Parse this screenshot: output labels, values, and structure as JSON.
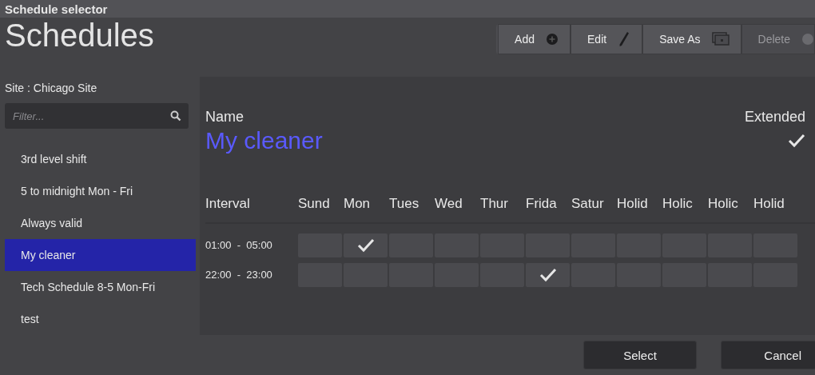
{
  "window": {
    "title": "Schedule selector"
  },
  "heading": "Schedules",
  "toolbar": [
    {
      "label": "Add",
      "kind": "add",
      "disabled": false
    },
    {
      "label": "Edit",
      "kind": "edit",
      "disabled": false
    },
    {
      "label": "Save As",
      "kind": "saveas",
      "disabled": false
    },
    {
      "label": "Delete",
      "kind": "delete",
      "disabled": true
    }
  ],
  "site": "Site :  Chicago Site",
  "filter": {
    "placeholder": "Filter..."
  },
  "schedules": [
    {
      "label": "3rd level shift",
      "selected": false
    },
    {
      "label": "5 to midnight Mon - Fri",
      "selected": false
    },
    {
      "label": "Always valid",
      "selected": false
    },
    {
      "label": "My cleaner",
      "selected": true
    },
    {
      "label": "Tech Schedule 8-5  Mon-Fri",
      "selected": false
    },
    {
      "label": "test",
      "selected": false
    }
  ],
  "detail": {
    "name_label": "Name",
    "name": "My cleaner",
    "extended_label": "Extended",
    "extended": true,
    "columns": [
      "Interval",
      "Sund",
      "Mon",
      "Tues",
      "Wed",
      "Thur",
      "Frida",
      "Satur",
      "Holid",
      "Holic",
      "Holic",
      "Holid"
    ],
    "rows": [
      {
        "interval": "01:00  -  05:00",
        "days": [
          false,
          true,
          false,
          false,
          false,
          false,
          false,
          false,
          false,
          false,
          false
        ]
      },
      {
        "interval": "22:00  -  23:00",
        "days": [
          false,
          false,
          false,
          false,
          false,
          true,
          false,
          false,
          false,
          false,
          false
        ]
      }
    ]
  },
  "buttons": [
    {
      "label": "Select",
      "kind": "primary"
    },
    {
      "label": "Cancel",
      "kind": "secondary"
    }
  ]
}
